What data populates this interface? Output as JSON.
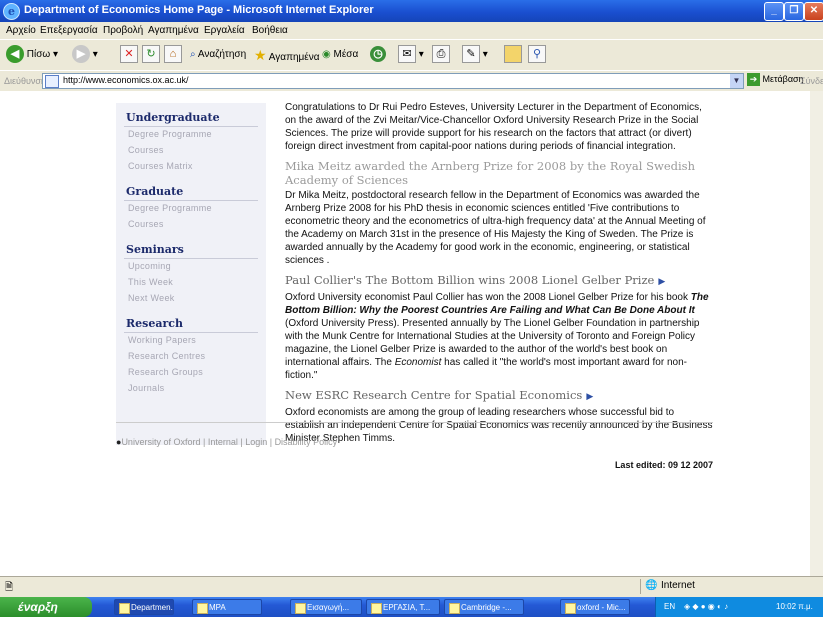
{
  "window": {
    "title": "Department of Economics Home Page - Microsoft Internet Explorer"
  },
  "menu": [
    "Αρχείο",
    "Επεξεργασία",
    "Προβολή",
    "Αγαπημένα",
    "Εργαλεία",
    "Βοήθεια"
  ],
  "toolbar": {
    "back": "Πίσω",
    "search": "Αναζήτηση",
    "favorites": "Αγαπημένα",
    "media": "Μέσα"
  },
  "address": {
    "label": "Διεύθυνση",
    "url": "http://www.economics.ox.ac.uk/",
    "go": "Μετάβαση",
    "links": "Σύνδεσμοι"
  },
  "sidebar": [
    {
      "title": "Undergraduate",
      "items": [
        "Degree Programme",
        "Courses",
        "Courses Matrix"
      ]
    },
    {
      "title": "Graduate",
      "items": [
        "Degree Programme",
        "Courses"
      ]
    },
    {
      "title": "Seminars",
      "items": [
        "Upcoming",
        "This Week",
        "Next Week"
      ]
    },
    {
      "title": "Research",
      "items": [
        "Working Papers",
        "Research Centres",
        "Research Groups",
        "Journals"
      ]
    }
  ],
  "news": {
    "intro": "Congratulations to Dr Rui Pedro Esteves, University Lecturer in the Department of Economics, on the award of the Zvi Meitar/Vice-Chancellor Oxford University Research Prize in the Social Sciences. The prize will provide support for his research on the factors that attract (or divert) foreign direct investment from capital-poor nations during periods of financial integration.",
    "h1": "Mika Meitz awarded the Arnberg Prize for 2008 by the Royal Swedish Academy of Sciences",
    "p1": "Dr Mika Meitz, postdoctoral research fellow in the Department of Economics was awarded the Arnberg Prize 2008 for his PhD thesis in economic sciences entitled 'Five contributions to econometric theory and the econometrics of ultra-high frequency data' at the Annual Meeting of the Academy on March 31st in the presence of His Majesty the King of Sweden. The Prize is awarded annually by the Academy for good work in the economic, engineering, or statistical sciences .",
    "h2": "Paul Collier's The Bottom Billion wins 2008 Lionel Gelber Prize",
    "p2a": "Oxford University economist Paul Collier has won the 2008 Lionel Gelber Prize for his book ",
    "p2book": "The Bottom Billion: Why the Poorest Countries Are Failing and What Can Be Done About It",
    "p2b": " (Oxford University Press). Presented annually by The Lionel Gelber Foundation in partnership with the Munk Centre for International Studies at the University of Toronto and Foreign Policy magazine, the Lionel Gelber Prize is awarded to the author of the world's best book on international affairs. The ",
    "p2mag": "Economist",
    "p2c": " has called it \"the world's most important award for non-fiction.\"",
    "h3": "New ESRC Research Centre for Spatial Economics",
    "p3": "Oxford economists are among the group of leading researchers whose successful bid to establish an independent Centre for Spatial Economics was recently announced by the Business Minister Stephen Timms.",
    "lastEdited": "Last edited: 09 12 2007"
  },
  "footer": {
    "university": "University of Oxford",
    "internal": "Internal",
    "login": "Login",
    "privacy": "Disability Policy"
  },
  "status": {
    "zone": "Internet"
  },
  "taskbar": {
    "start": "έναρξη",
    "tasks": [
      "Departmen...",
      "MPA",
      "Εισαγωγή...",
      "ΕΡΓΑΣΙΑ, Τ...",
      "Cambridge -...",
      "oxford - Mic..."
    ],
    "lang": "EN",
    "clock": "10:02 π.μ."
  }
}
